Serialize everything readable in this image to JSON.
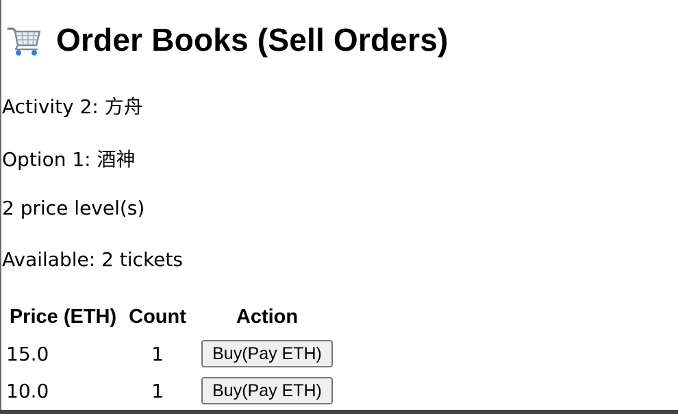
{
  "header": {
    "icon": "shopping-cart-icon",
    "title": "Order Books (Sell Orders)"
  },
  "info": {
    "activity": "Activity 2: 方舟",
    "option": "Option 1: 酒神",
    "price_levels": "2 price level(s)",
    "available": "Available: 2 tickets"
  },
  "table": {
    "columns": [
      "Price (ETH)",
      "Count",
      "Action"
    ],
    "rows": [
      {
        "price": "15.0",
        "count": "1",
        "action_label": "Buy(Pay ETH)"
      },
      {
        "price": "10.0",
        "count": "1",
        "action_label": "Buy(Pay ETH)"
      }
    ]
  }
}
